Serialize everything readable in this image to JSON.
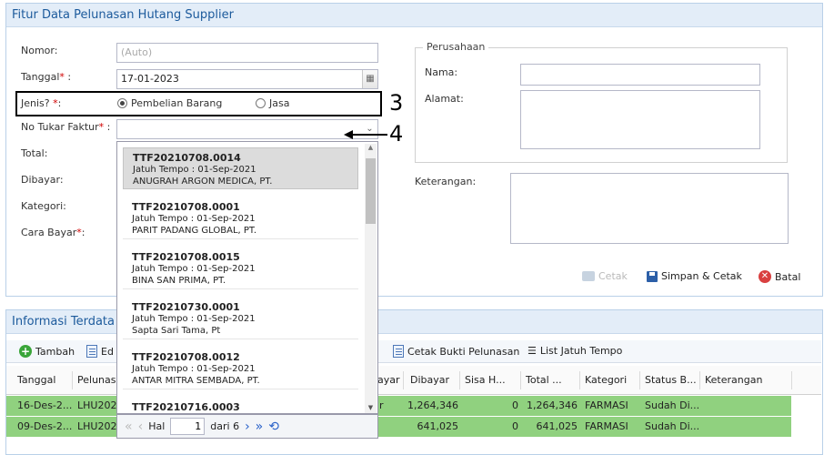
{
  "top_panel": {
    "title": "Fitur Data Pelunasan Hutang Supplier"
  },
  "form": {
    "nomor_label": "Nomor:",
    "nomor_placeholder": "(Auto)",
    "tanggal_label": "Tanggal",
    "tanggal_value": "17-01-2023",
    "jenis_label": "Jenis? ",
    "jenis_options": [
      "Pembelian Barang",
      "Jasa"
    ],
    "jenis_selected": "Pembelian Barang",
    "no_tukar_label": "No Tukar Faktur",
    "no_tukar_value": "",
    "total_label": "Total:",
    "dibayar_label": "Dibayar:",
    "kategori_label": "Kategori:",
    "cara_bayar_label": "Cara Bayar",
    "req_mark": "*",
    "colon": ":"
  },
  "perusahaan": {
    "legend": "Perusahaan",
    "nama_label": "Nama:",
    "alamat_label": "Alamat:",
    "keterangan_label": "Keterangan:"
  },
  "actions": {
    "cetak": "Cetak",
    "simpan_cetak": "Simpan & Cetak",
    "batal": "Batal"
  },
  "annotations": {
    "box_number": "3",
    "arrow_number": "4"
  },
  "dropdown": {
    "items": [
      {
        "code": "TTF20210708.0014",
        "due": "Jatuh Tempo : 01-Sep-2021",
        "company": "ANUGRAH ARGON MEDICA, PT."
      },
      {
        "code": "TTF20210708.0001",
        "due": "Jatuh Tempo : 01-Sep-2021",
        "company": "PARIT PADANG GLOBAL, PT."
      },
      {
        "code": "TTF20210708.0015",
        "due": "Jatuh Tempo : 01-Sep-2021",
        "company": "BINA SAN PRIMA, PT."
      },
      {
        "code": "TTF20210730.0001",
        "due": "Jatuh Tempo : 01-Sep-2021",
        "company": "Sapta Sari Tama, Pt"
      },
      {
        "code": "TTF20210708.0012",
        "due": "Jatuh Tempo : 01-Sep-2021",
        "company": "ANTAR MITRA SEMBADA, PT."
      },
      {
        "code": "TTF20210716.0003",
        "due": "",
        "company": ""
      }
    ],
    "pager": {
      "hal_label": "Hal",
      "page": "1",
      "of_label": "dari 6"
    }
  },
  "bottom_panel": {
    "title": "Informasi Terdata",
    "toolbar": {
      "tambah": "Tambah",
      "edit": "Ed",
      "cetak_bukti": "Cetak Bukti Pelunasan",
      "list_jatuh_tempo": "List Jatuh Tempo"
    }
  },
  "grid": {
    "headers": {
      "tanggal": "Tanggal",
      "pelunasan": "Pelunasa",
      "bayar": "ayar",
      "dibayar": "Dibayar",
      "sisa": "Sisa H...",
      "total": "Total ...",
      "kategori": "Kategori",
      "status": "Status B...",
      "keterangan": "Keterangan"
    },
    "rows": [
      {
        "tanggal": "16-Des-2...",
        "pelunasan": "LHU2022",
        "bayar": "r",
        "dibayar": "1,264,346",
        "sisa": "0",
        "total": "1,264,346",
        "kategori": "FARMASI",
        "status": "Sudah Di..."
      },
      {
        "tanggal": "09-Des-2...",
        "pelunasan": "LHU2022",
        "bayar": "",
        "dibayar": "641,025",
        "sisa": "0",
        "total": "641,025",
        "kategori": "FARMASI",
        "status": "Sudah Di..."
      }
    ]
  },
  "colors": {
    "accent": "#1c5a9c",
    "row_green": "#90d17f",
    "required": "#d00000"
  }
}
